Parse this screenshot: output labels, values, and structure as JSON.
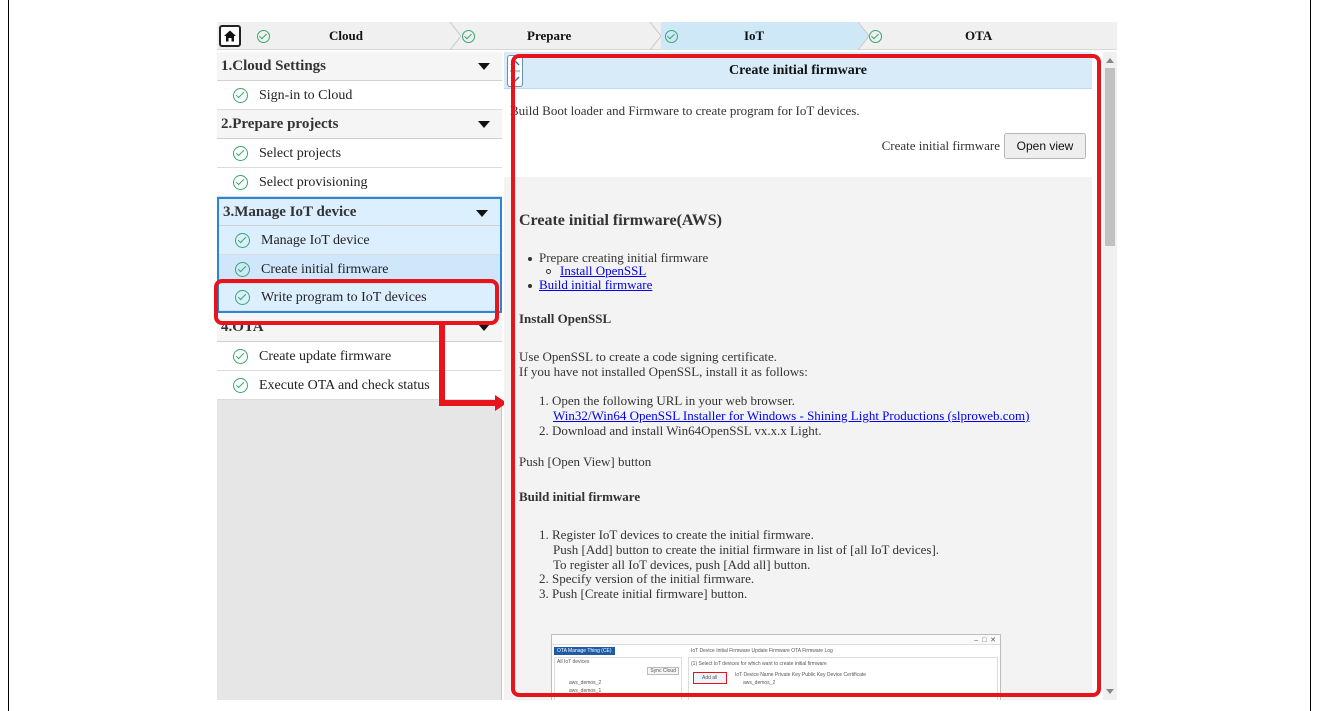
{
  "stepper": {
    "steps": [
      {
        "label": "Cloud"
      },
      {
        "label": "Prepare"
      },
      {
        "label": "IoT"
      },
      {
        "label": "OTA"
      }
    ]
  },
  "sidebar": {
    "sections": [
      {
        "title": "1.Cloud Settings",
        "items": [
          "Sign-in to Cloud"
        ]
      },
      {
        "title": "2.Prepare projects",
        "items": [
          "Select projects",
          "Select provisioning"
        ]
      },
      {
        "title": "3.Manage IoT device",
        "items": [
          "Manage IoT device",
          "Create initial firmware",
          "Write program to IoT devices"
        ]
      },
      {
        "title": "4.OTA",
        "items": [
          "Create update firmware",
          "Execute OTA and check status"
        ]
      }
    ]
  },
  "main": {
    "title": "Create initial firmware",
    "intro": "Build Boot loader and Firmware to create program for IoT devices.",
    "open_label": "Create initial firmware",
    "open_button": "Open view",
    "doc": {
      "heading": "Create initial firmware(AWS)",
      "toc_prepare": "Prepare creating initial firmware",
      "toc_install": "Install OpenSSL",
      "toc_build": "Build initial firmware",
      "install_heading": "Install OpenSSL",
      "install_p1": "Use OpenSSL to create a code signing certificate.",
      "install_p2": "If you have not installed OpenSSL, install it as follows:",
      "install_step1": "1. Open the following URL in your web browser.",
      "install_link": "Win32/Win64 OpenSSL Installer for Windows - Shining Light Productions (slproweb.com)",
      "install_step2": "2. Download and install Win64OpenSSL vx.x.x Light.",
      "push_open": "Push [Open View] button",
      "build_heading": "Build initial firmware",
      "build_step1": "1. Register IoT devices to create the initial firmware.",
      "build_step1b": "Push [Add] button to create the initial firmware in list of [all IoT devices].",
      "build_step1c": "To register all IoT devices, push [Add all] button.",
      "build_step2": "2. Specify version of the initial firmware.",
      "build_step3": "3. Push [Create initial firmware] button."
    },
    "screenshot": {
      "window_tab": "OTA Manage Thing (CE)",
      "left_title": "All IoT devices",
      "sync": "Sync Cloud",
      "tabs": "IoT Device   Initial Firmware   Update Firmware   OTA   Firmware Log",
      "hint": "(1) Select IoT devices for which want to create initial firmware",
      "add_all": "Add all",
      "col_headers": "IoT Device Name   Private Key   Public Key   Device Certificate",
      "dev1": "aws_demos_2",
      "dev2": "aws_demos_1",
      "row1": "aws_demos_2"
    }
  }
}
